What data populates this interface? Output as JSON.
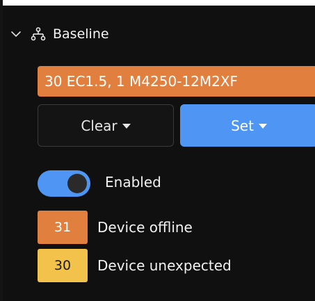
{
  "header": {
    "title": "Baseline",
    "icons": [
      "chevron-down-icon",
      "network-icon"
    ]
  },
  "baseline": {
    "value": "30 EC1.5, 1 M4250-12M2XF"
  },
  "buttons": {
    "clear_label": "Clear",
    "set_label": "Set"
  },
  "toggle": {
    "label": "Enabled",
    "state": "on"
  },
  "statuses": [
    {
      "count": "31",
      "label": "Device offline",
      "color": "#E07F3E"
    },
    {
      "count": "30",
      "label": "Device unexpected",
      "color": "#F2C24B"
    }
  ],
  "colors": {
    "accent_blue": "#4F95F3",
    "orange": "#E07F3E",
    "yellow": "#F2C24B",
    "background": "#101010"
  }
}
